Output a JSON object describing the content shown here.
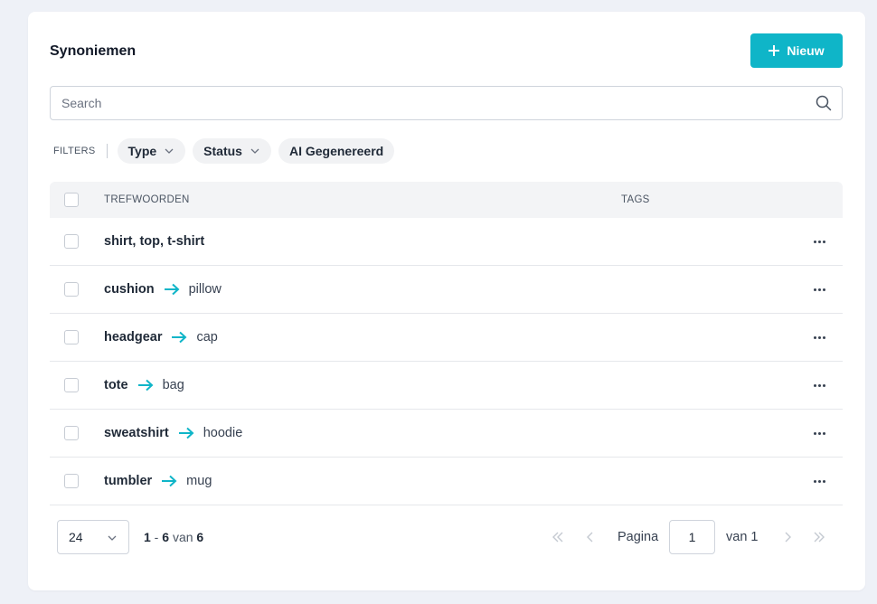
{
  "header": {
    "title": "Synoniemen",
    "new_label": "Nieuw"
  },
  "search": {
    "placeholder": "Search",
    "value": ""
  },
  "filters": {
    "label": "FILTERS",
    "chips": [
      {
        "label": "Type",
        "has_dropdown": true
      },
      {
        "label": "Status",
        "has_dropdown": true
      },
      {
        "label": "AI Gegenereerd",
        "has_dropdown": false
      }
    ]
  },
  "table": {
    "columns": {
      "keywords": "TREFWOORDEN",
      "tags": "TAGS"
    },
    "rows": [
      {
        "term": "shirt, top, t-shirt",
        "target": ""
      },
      {
        "term": "cushion",
        "target": "pillow"
      },
      {
        "term": "headgear",
        "target": "cap"
      },
      {
        "term": "tote",
        "target": "bag"
      },
      {
        "term": "sweatshirt",
        "target": "hoodie"
      },
      {
        "term": "tumbler",
        "target": "mug"
      }
    ]
  },
  "pagination": {
    "page_size": "24",
    "range_start": "1",
    "range_end": "6",
    "range_of": "van",
    "total": "6",
    "page_label": "Pagina",
    "current_page": "1",
    "of_label": "van 1"
  },
  "colors": {
    "accent": "#0fb5c8",
    "background": "#eef1f7"
  },
  "icons": {
    "new": "plus-icon",
    "search": "search-icon",
    "dropdown": "chevron-down-icon",
    "mapping": "arrow-right-icon",
    "row_actions": "more-horizontal-icon",
    "first": "chevrons-left-icon",
    "prev": "chevron-left-icon",
    "next": "chevron-right-icon",
    "last": "chevrons-right-icon"
  }
}
